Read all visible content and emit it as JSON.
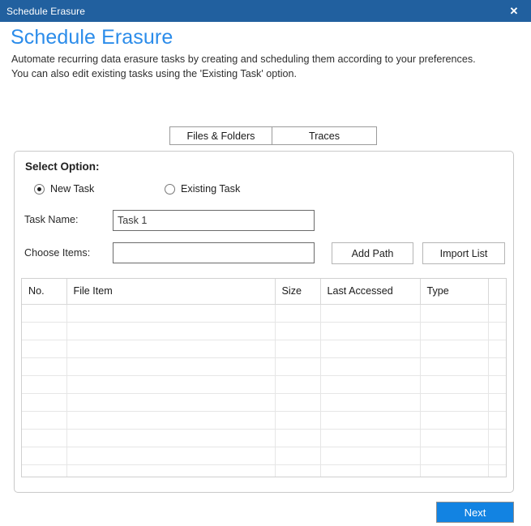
{
  "window": {
    "title": "Schedule Erasure",
    "close_icon": "close-icon",
    "close_glyph": "✕"
  },
  "header": {
    "title": "Schedule Erasure",
    "description_line1": "Automate recurring data erasure tasks by creating and scheduling them according to your preferences.",
    "description_line2": "You can also edit existing tasks using the 'Existing Task' option."
  },
  "tabs": [
    {
      "label": "Files & Folders",
      "selected": true
    },
    {
      "label": "Traces",
      "selected": false
    }
  ],
  "panel": {
    "title": "Select Option:",
    "radios": [
      {
        "label": "New Task",
        "checked": true
      },
      {
        "label": "Existing Task",
        "checked": false
      }
    ],
    "fields": {
      "task_name_label": "Task Name:",
      "task_name_value": "Task 1",
      "task_name_placeholder": "",
      "choose_items_label": "Choose Items:",
      "choose_items_value": "",
      "choose_items_placeholder": ""
    },
    "buttons": {
      "add_path": "Add Path",
      "import_list": "Import List"
    },
    "table": {
      "columns": [
        "No.",
        "File Item",
        "Size",
        "Last Accessed",
        "Type",
        ""
      ],
      "rows": [
        [
          "",
          "",
          "",
          "",
          "",
          ""
        ],
        [
          "",
          "",
          "",
          "",
          "",
          ""
        ],
        [
          "",
          "",
          "",
          "",
          "",
          ""
        ],
        [
          "",
          "",
          "",
          "",
          "",
          ""
        ],
        [
          "",
          "",
          "",
          "",
          "",
          ""
        ],
        [
          "",
          "",
          "",
          "",
          "",
          ""
        ],
        [
          "",
          "",
          "",
          "",
          "",
          ""
        ],
        [
          "",
          "",
          "",
          "",
          "",
          ""
        ],
        [
          "",
          "",
          "",
          "",
          "",
          ""
        ],
        [
          "",
          "",
          "",
          "",
          "",
          ""
        ]
      ]
    }
  },
  "footer": {
    "next_label": "Next"
  },
  "colors": {
    "titlebar": "#21609f",
    "heading": "#2b8cea",
    "accent_button": "#1283e2",
    "panel_border": "#c9c9c9"
  }
}
